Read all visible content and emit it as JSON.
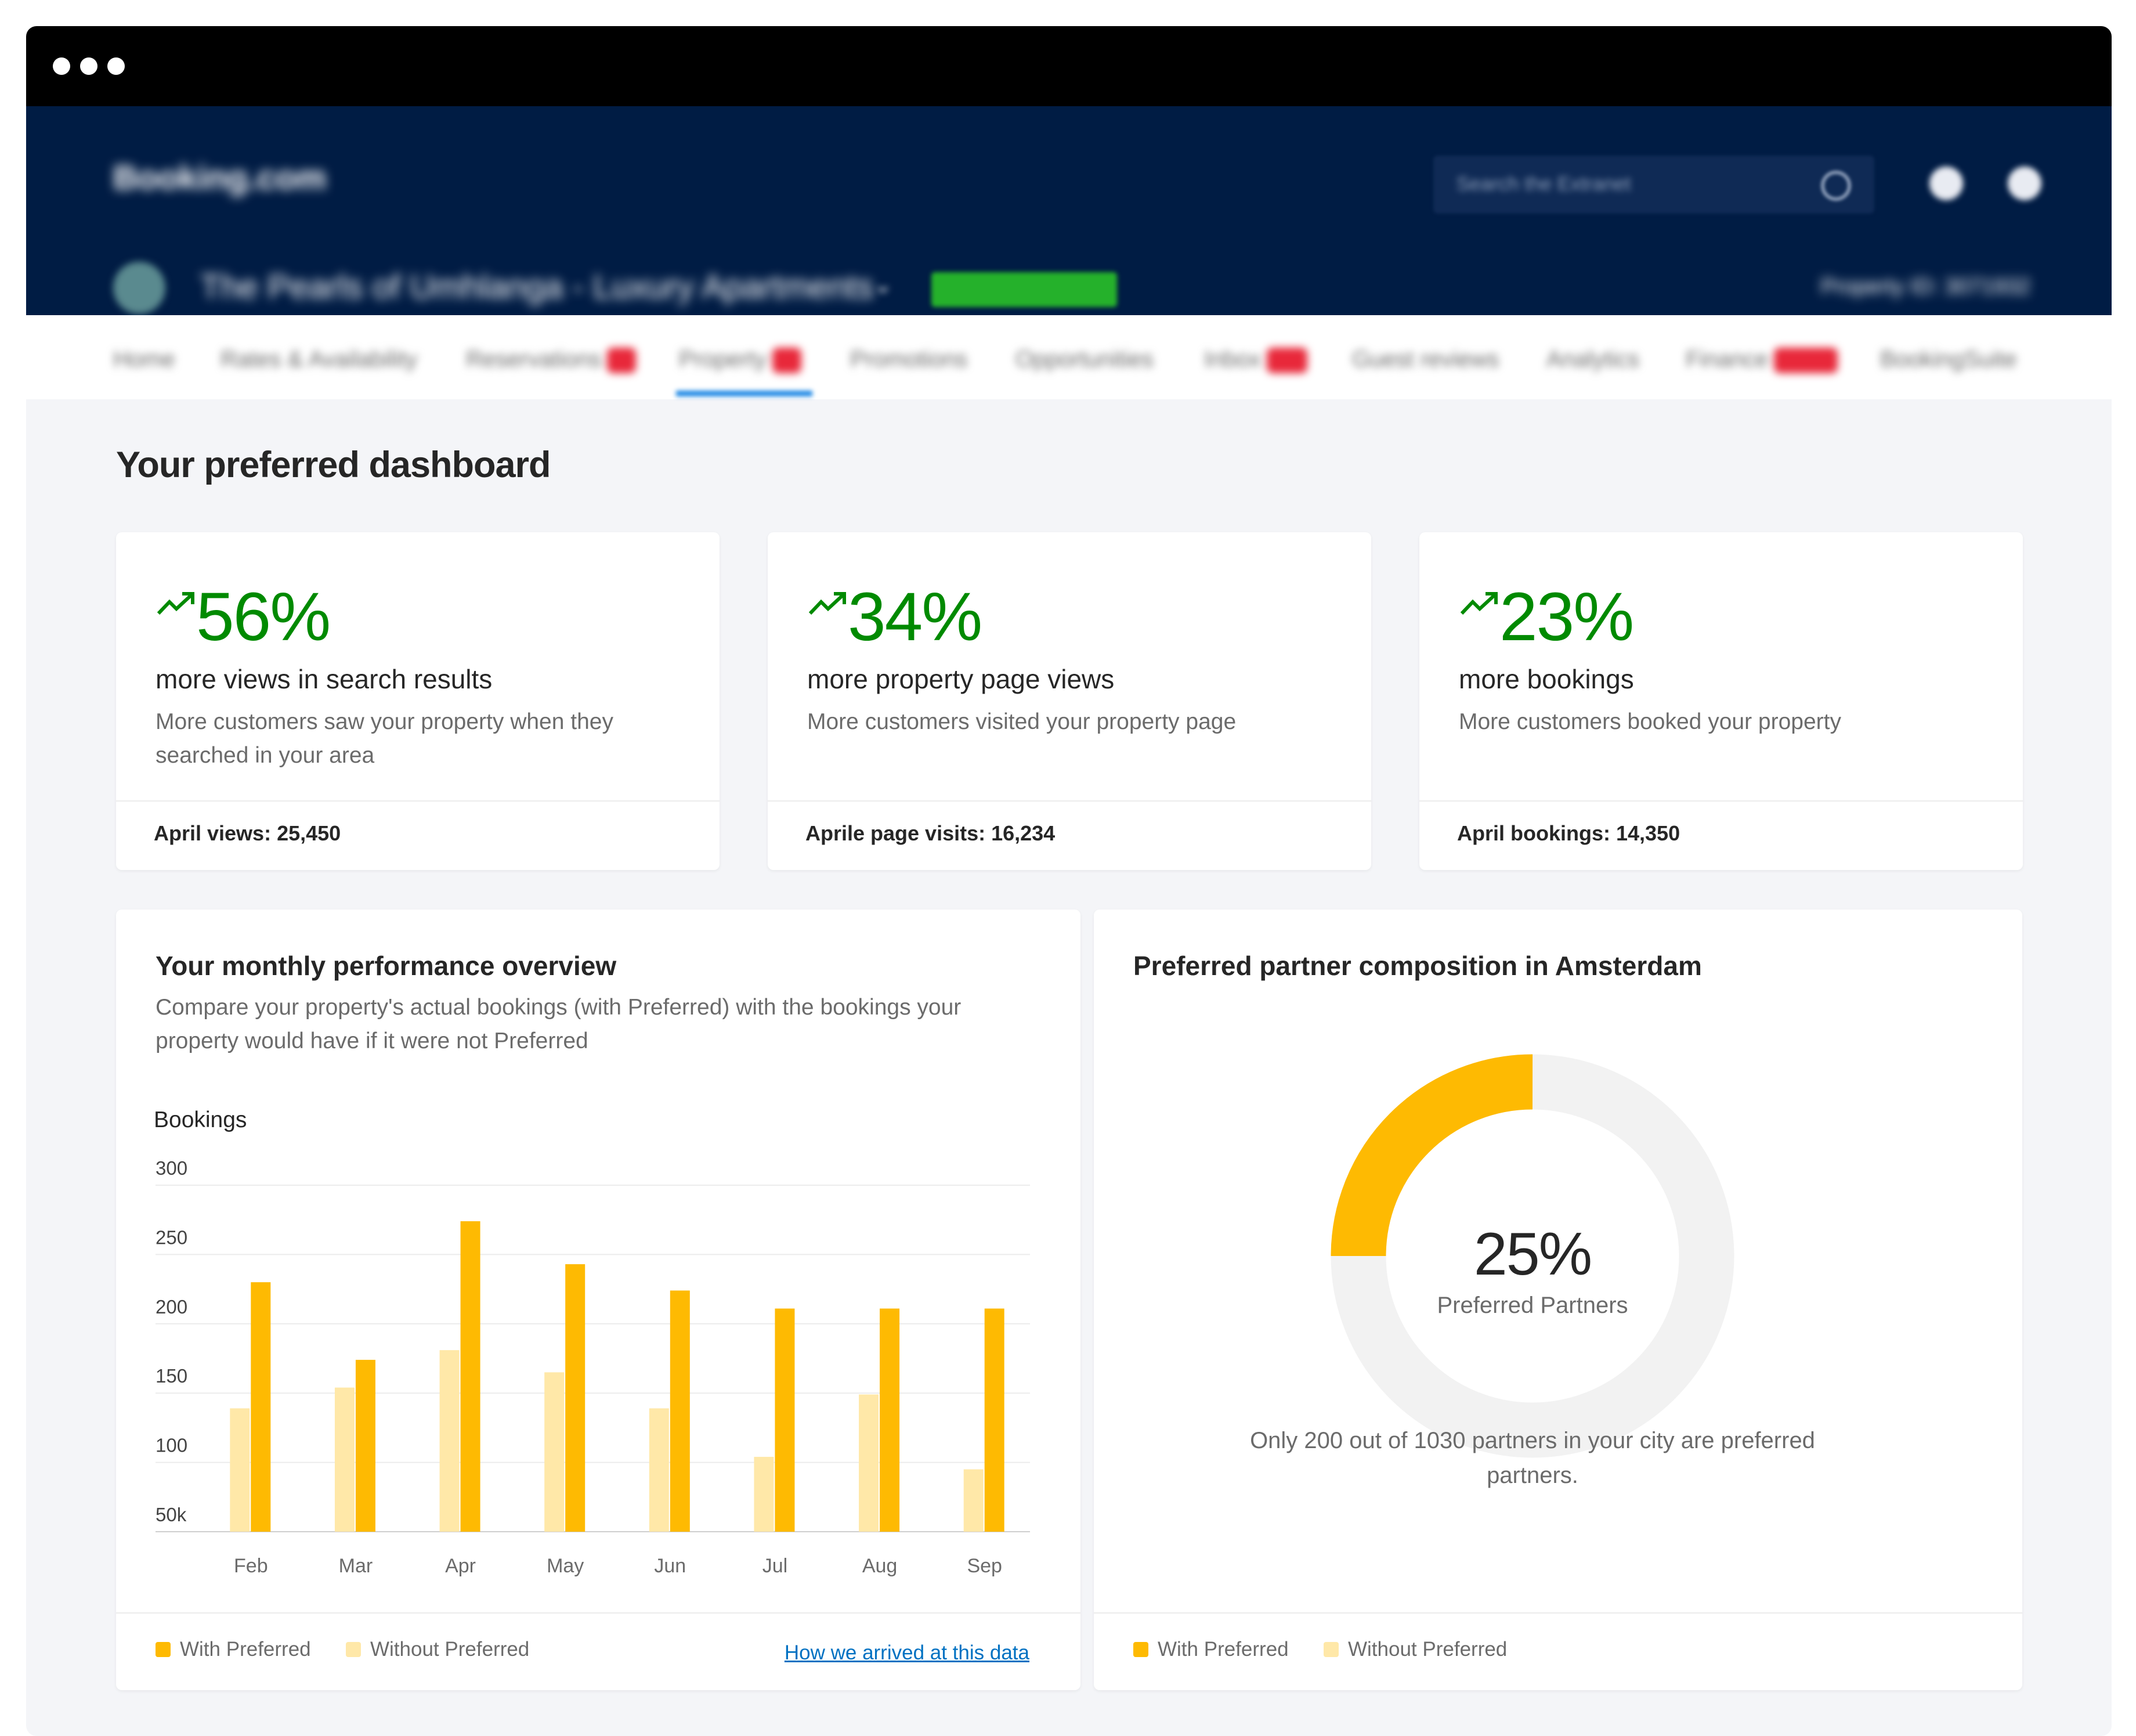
{
  "brand": "Booking.com",
  "search": {
    "placeholder": "Search the Extranet"
  },
  "property": {
    "name": "The Pearls of Umhlanga - Luxury Apartments",
    "status": "Open/Bookable",
    "id_label": "Property ID: 3071932"
  },
  "nav": {
    "items": [
      {
        "label": "Home",
        "badge": false
      },
      {
        "label": "Rates & Availability",
        "badge": false
      },
      {
        "label": "Reservations",
        "badge": true
      },
      {
        "label": "Property",
        "badge": true
      },
      {
        "label": "Promotions",
        "badge": false
      },
      {
        "label": "Opportunities",
        "badge": false
      },
      {
        "label": "Inbox",
        "badge": true
      },
      {
        "label": "Guest reviews",
        "badge": false
      },
      {
        "label": "Analytics",
        "badge": false
      },
      {
        "label": "Finance",
        "badge": true
      },
      {
        "label": "BookingSuite",
        "badge": false
      }
    ],
    "active": "Property"
  },
  "page": {
    "title": "Your preferred dashboard"
  },
  "kpis": [
    {
      "value": "56%",
      "label": "more views in search results",
      "description": "More customers saw your property when they searched in your area",
      "footer": "April views: 25,450"
    },
    {
      "value": "34%",
      "label": "more property page views",
      "description": "More customers visited your property page",
      "footer": "Aprile page visits: 16,234"
    },
    {
      "value": "23%",
      "label": "more bookings",
      "description": "More customers booked your property",
      "footer": "April bookings: 14,350"
    }
  ],
  "performance": {
    "title": "Your monthly performance overview",
    "subtitle": "Compare your property's actual bookings (with Preferred) with the bookings your property would have if it were not Preferred",
    "link": "How we arrived at this data"
  },
  "composition": {
    "title": "Preferred partner composition in Amsterdam",
    "percent_text": "25%",
    "percent_value": 25,
    "center_label": "Preferred Partners",
    "note": "Only 200 out of 1030 partners in your city are preferred partners."
  },
  "legend": {
    "with": "With Preferred",
    "without": "Without Preferred"
  },
  "colors": {
    "with": "#feba02",
    "without": "#ffe8a8",
    "track": "#f2f2f2",
    "positive": "#008a00"
  },
  "chart_data": {
    "type": "bar",
    "ylabel": "Bookings",
    "yticks": [
      "300",
      "250",
      "200",
      "150",
      "100",
      "50k"
    ],
    "ylim": [
      50,
      300
    ],
    "categories": [
      "Feb",
      "Mar",
      "Apr",
      "May",
      "Jun",
      "Jul",
      "Aug",
      "Sep"
    ],
    "series": [
      {
        "name": "Without Preferred",
        "values": [
          139,
          154,
          181,
          165,
          139,
          104,
          149,
          95
        ]
      },
      {
        "name": "With Preferred",
        "values": [
          230,
          174,
          274,
          243,
          224,
          211,
          211,
          211
        ]
      }
    ],
    "grid": true,
    "legend": "bottom-left"
  }
}
